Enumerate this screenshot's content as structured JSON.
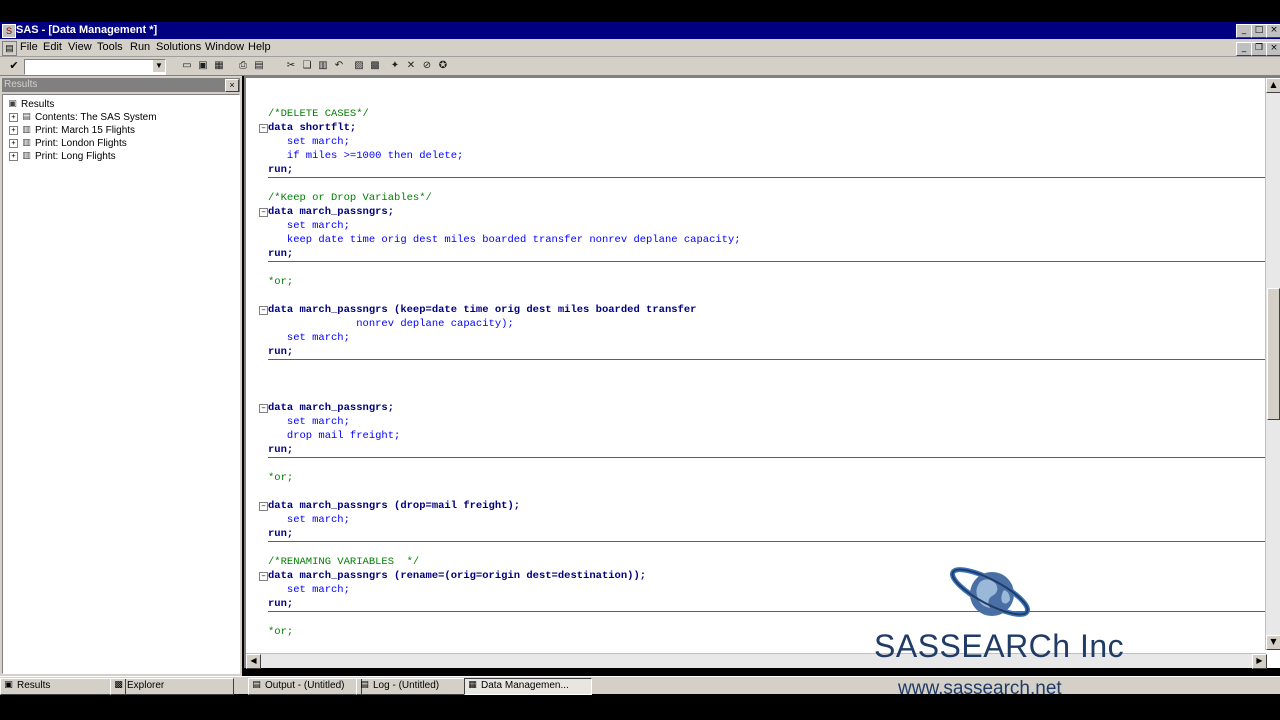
{
  "window": {
    "title": "SAS - [Data Management *]",
    "icon": "sas-app-icon"
  },
  "menu": [
    "File",
    "Edit",
    "View",
    "Tools",
    "Run",
    "Solutions",
    "Window",
    "Help"
  ],
  "toolbar": {
    "command_value": ""
  },
  "left_panel": {
    "caption": "Results",
    "tree": [
      {
        "label": "Results",
        "level": 0,
        "icon": "results-folder-icon"
      },
      {
        "label": "Contents:  The SAS System",
        "level": 1,
        "icon": "contents-icon"
      },
      {
        "label": "Print:  March 15 Flights",
        "level": 1,
        "icon": "print-output-icon"
      },
      {
        "label": "Print:  London Flights",
        "level": 1,
        "icon": "print-output-icon"
      },
      {
        "label": "Print:  Long Flights",
        "level": 1,
        "icon": "print-output-icon"
      }
    ]
  },
  "code": [
    {
      "text": "/*DELETE CASES*/"
    },
    {
      "text": "data shortflt;"
    },
    {
      "text": "   set march;"
    },
    {
      "text": "   if miles >=1000 then delete;"
    },
    {
      "text": "run;"
    },
    {
      "text": "/*Keep or Drop Variables*/"
    },
    {
      "text": "data march_passngrs;"
    },
    {
      "text": "   set march;"
    },
    {
      "text": "   keep date time orig dest miles boarded transfer nonrev deplane capacity;"
    },
    {
      "text": "run;"
    },
    {
      "text": "*or;"
    },
    {
      "text": "data march_passngrs (keep=date time orig dest miles boarded transfer"
    },
    {
      "text": "              nonrev deplane capacity);"
    },
    {
      "text": "   set march;"
    },
    {
      "text": "run;"
    },
    {
      "text": "data march_passngrs;"
    },
    {
      "text": "   set march;"
    },
    {
      "text": "   drop mail freight;"
    },
    {
      "text": "run;"
    },
    {
      "text": "*or;"
    },
    {
      "text": "data march_passngrs (drop=mail freight);"
    },
    {
      "text": "   set march;"
    },
    {
      "text": "run;"
    },
    {
      "text": "/*RENAMING VARIABLES  */"
    },
    {
      "text": "data march_passngrs (rename=(orig=origin dest=destination));"
    },
    {
      "text": "   set march;"
    },
    {
      "text": "run;"
    },
    {
      "text": "*or;"
    }
  ],
  "taskbar": {
    "dock_tabs": [
      "Results",
      "Explorer"
    ],
    "windows": [
      "Output - (Untitled)",
      "Log - (Untitled)",
      "Data Managemen..."
    ]
  },
  "watermark": {
    "company": "SASSEARCh Inc",
    "url": "www.sassearch.net"
  },
  "colors": {
    "titlebar": "#000080",
    "chrome": "#d4d0c8",
    "comment": "#008000",
    "keyword": "#000080",
    "code": "#0000ff"
  }
}
